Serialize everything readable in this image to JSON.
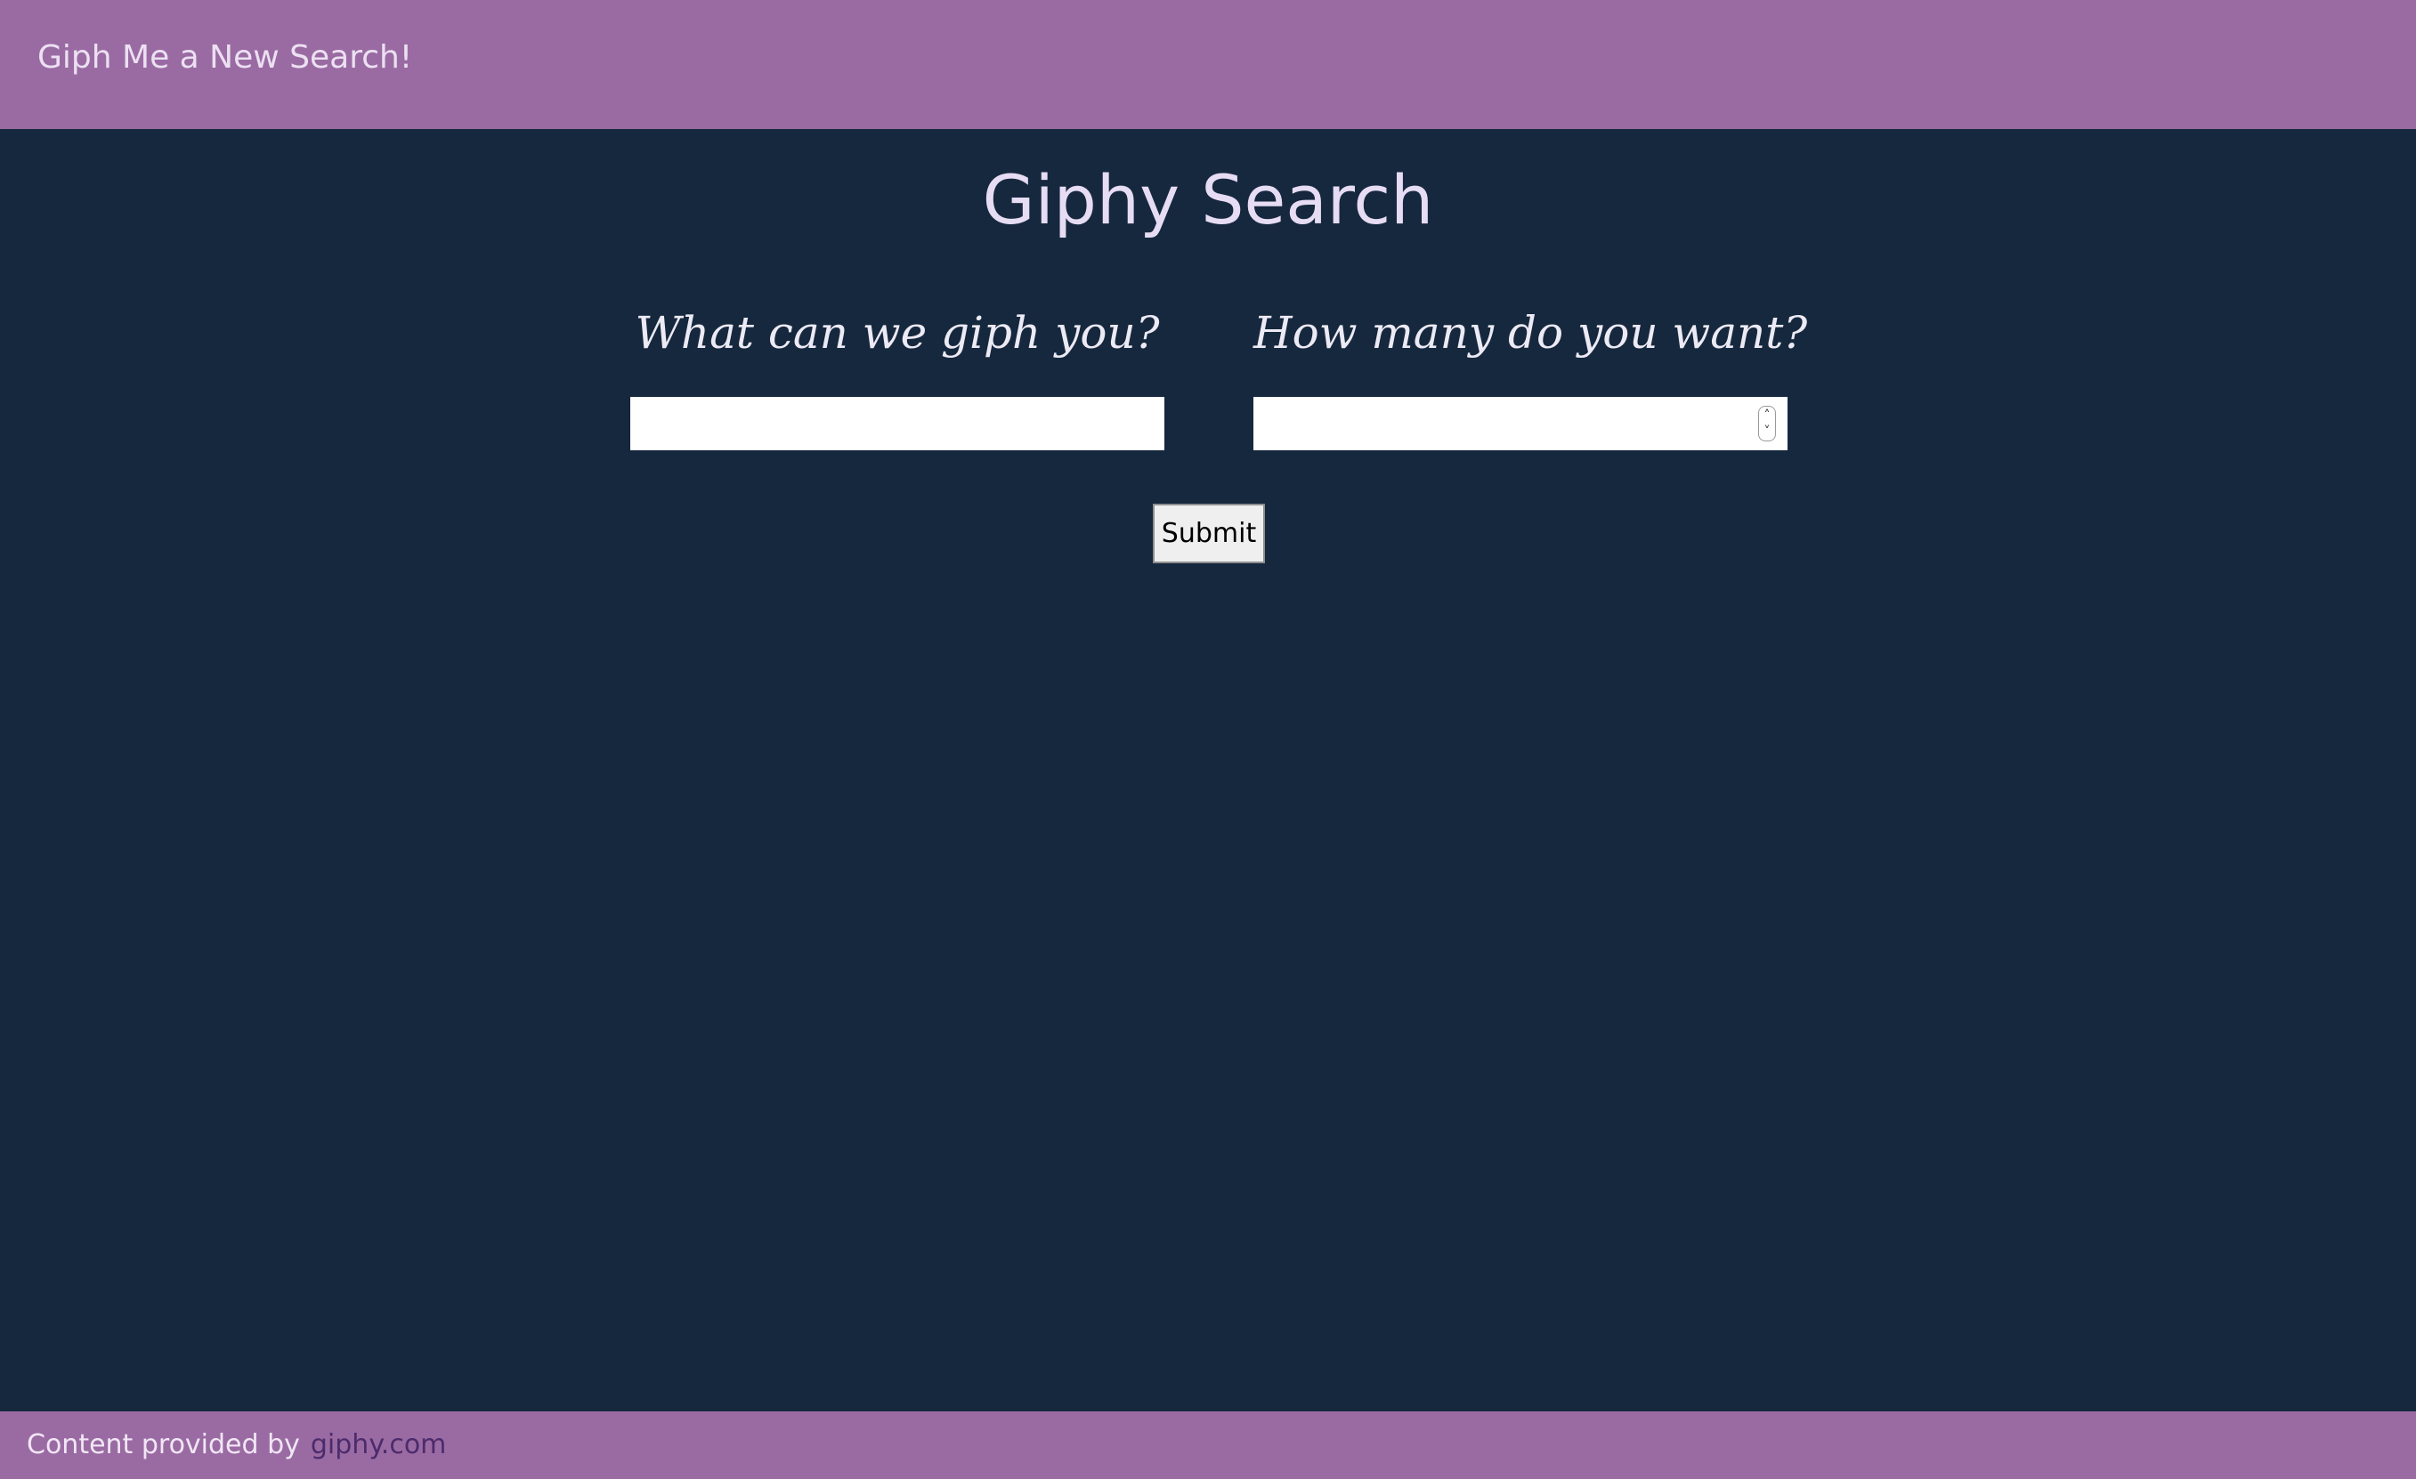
{
  "navbar": {
    "brand": "Giph Me a New Search!"
  },
  "main": {
    "title": "Giphy Search",
    "search_label": "What can we giph you?",
    "search_value": "",
    "count_label": "How many do you want?",
    "count_value": "",
    "submit_label": "Submit"
  },
  "footer": {
    "credit_text": "Content provided by",
    "credit_link": "giphy.com"
  },
  "colors": {
    "background": "#16283e",
    "bar": "#9a6ba3",
    "title": "#e6dcf4",
    "link": "#4c2b6c"
  },
  "icons": {
    "spinner_up": "chevron-up-icon",
    "spinner_down": "chevron-down-icon"
  }
}
